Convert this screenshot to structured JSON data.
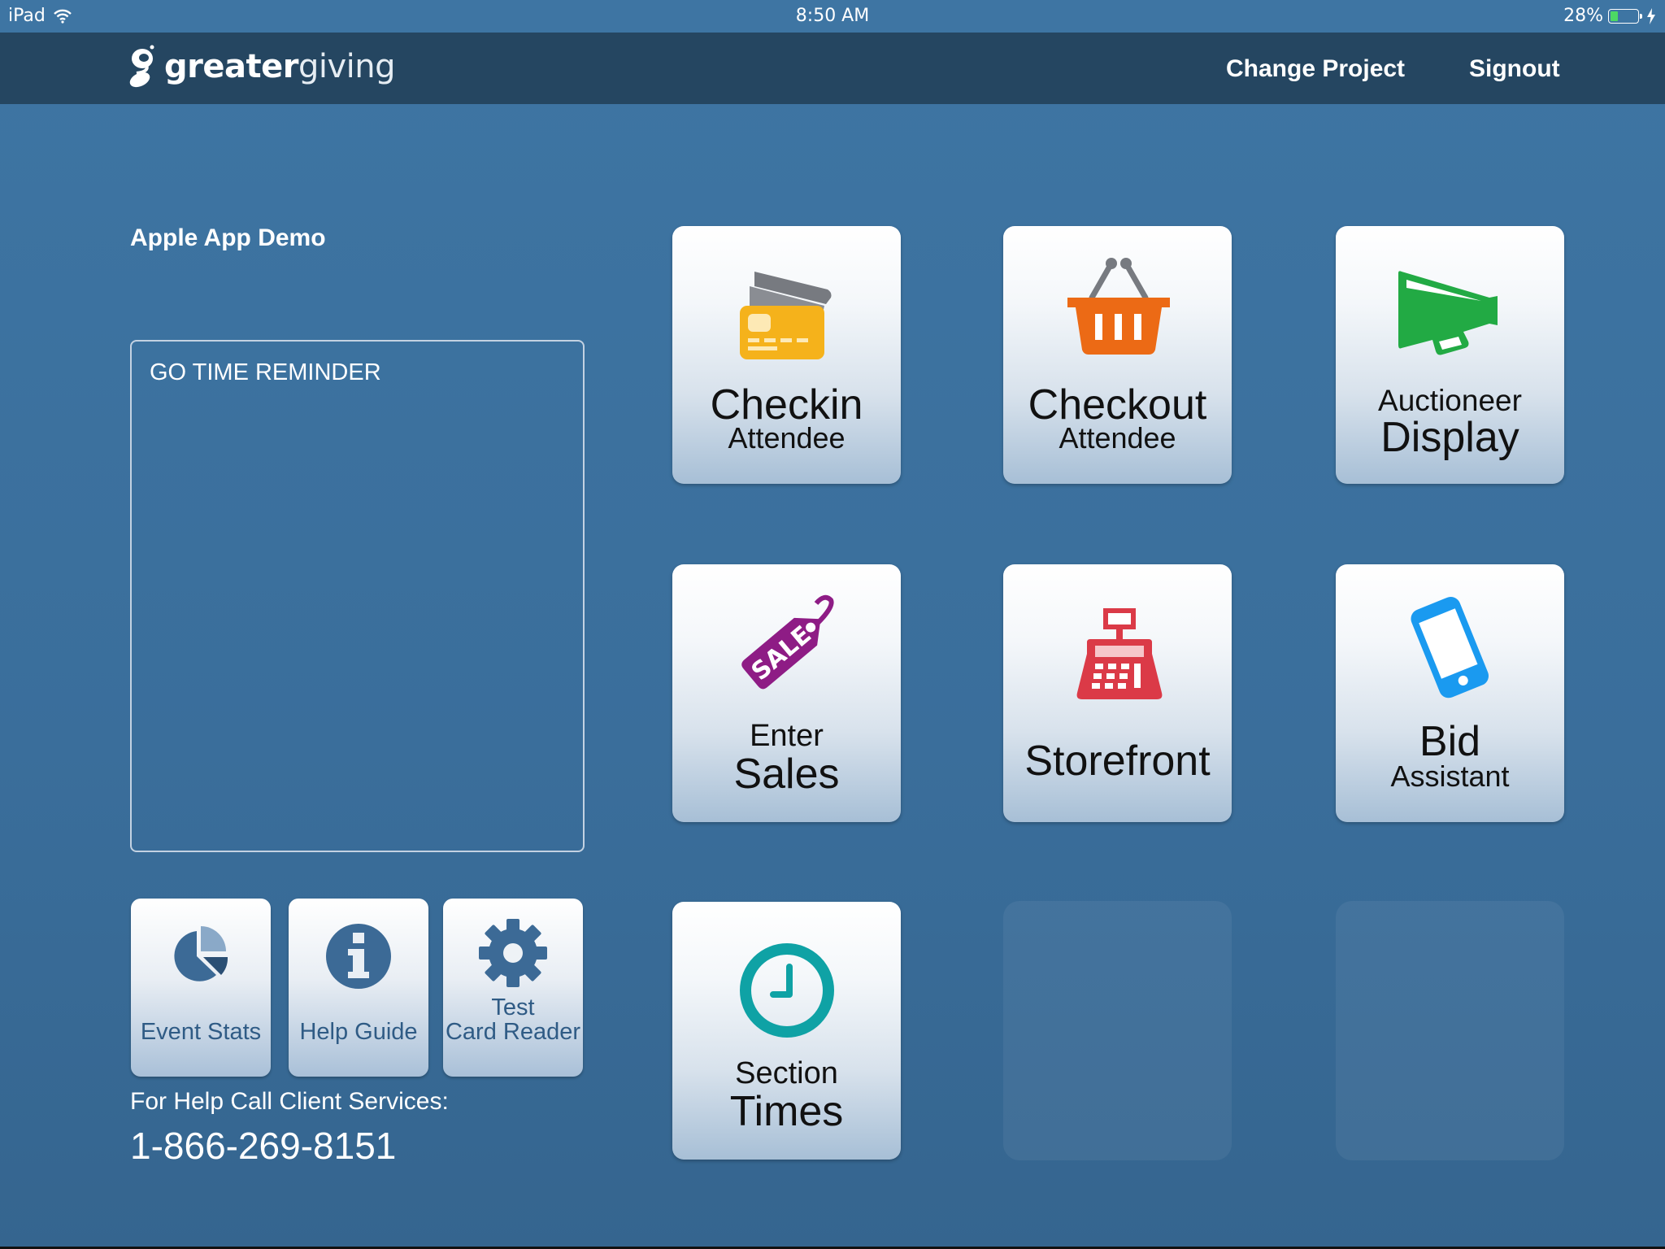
{
  "status_bar": {
    "device": "iPad",
    "time": "8:50 AM",
    "battery_percent_label": "28%",
    "battery_level": 0.28,
    "wifi_icon": "wifi-icon",
    "charging_icon": "bolt-icon"
  },
  "navbar": {
    "logo_bold": "greater",
    "logo_light": "giving",
    "change_project": "Change Project",
    "signout": "Signout"
  },
  "project": {
    "title": "Apple App Demo"
  },
  "reminder": {
    "title": "GO TIME REMINDER"
  },
  "small_buttons": [
    {
      "label_1": "Event Stats",
      "label_2": "",
      "icon": "pie-chart-icon"
    },
    {
      "label_1": "Help Guide",
      "label_2": "",
      "icon": "info-icon"
    },
    {
      "label_1": "Test",
      "label_2": "Card Reader",
      "icon": "gear-icon"
    }
  ],
  "help": {
    "text": "For Help Call Client Services:",
    "phone": "1-866-269-8151"
  },
  "tiles": [
    {
      "line1": "Checkin",
      "line2": "Attendee",
      "icon": "credit-card-icon",
      "color": "#f5b21b"
    },
    {
      "line1": "Checkout",
      "line2": "Attendee",
      "icon": "basket-icon",
      "color": "#ec6a15"
    },
    {
      "line1": "Auctioneer",
      "line2": "Display",
      "icon": "megaphone-icon",
      "color": "#22aa44"
    },
    {
      "line1": "Enter",
      "line2": "Sales",
      "icon": "sale-tag-icon",
      "color": "#8e1c85",
      "tag_text": "SALE"
    },
    {
      "line1": "Storefront",
      "line2": "",
      "icon": "cash-register-icon",
      "color": "#db3a47"
    },
    {
      "line1": "Bid",
      "line2": "Assistant",
      "icon": "smartphone-icon",
      "color": "#1a9af0"
    },
    {
      "line1": "Section",
      "line2": "Times",
      "icon": "clock-icon",
      "color": "#0fa2a5"
    }
  ]
}
